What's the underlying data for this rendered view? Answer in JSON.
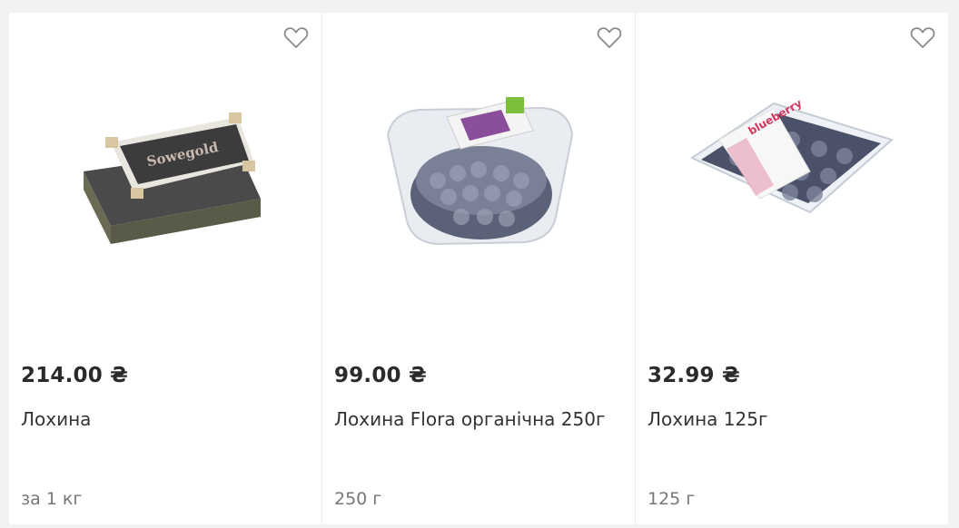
{
  "products": [
    {
      "price": "214.00 ₴",
      "name": "Лохина",
      "unit": "за 1 кг",
      "image": "blueberry-crate",
      "box_label": "Sowegold"
    },
    {
      "price": "99.00 ₴",
      "name": "Лохина Flora органічна 250г",
      "unit": "250 г",
      "image": "blueberry-plastic-tub"
    },
    {
      "price": "32.99 ₴",
      "name": "Лохина 125г",
      "unit": "125 г",
      "image": "blueberry-clamshell",
      "box_label": "blueberry"
    }
  ],
  "colors": {
    "price": "#2b2b2b",
    "unit": "#777777",
    "heart": "#8a8a8a"
  }
}
